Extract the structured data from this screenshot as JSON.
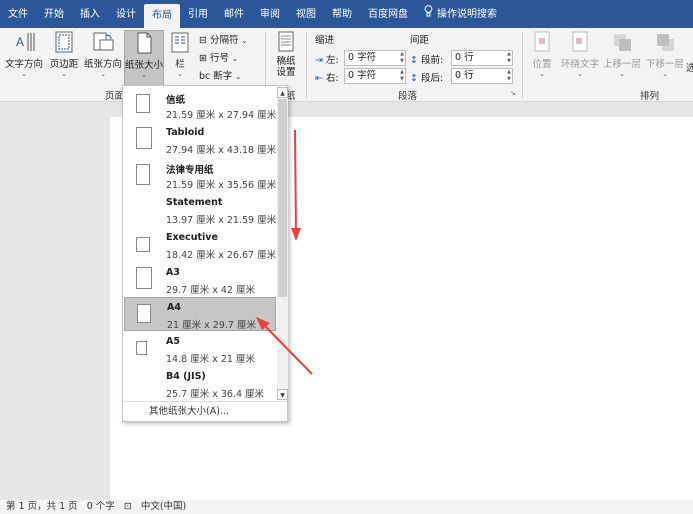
{
  "tabs": [
    {
      "label": "文件"
    },
    {
      "label": "开始"
    },
    {
      "label": "插入"
    },
    {
      "label": "设计"
    },
    {
      "label": "布局"
    },
    {
      "label": "引用"
    },
    {
      "label": "邮件"
    },
    {
      "label": "审阅"
    },
    {
      "label": "视图"
    },
    {
      "label": "帮助"
    },
    {
      "label": "百度网盘"
    },
    {
      "label": "操作说明搜索"
    }
  ],
  "ribbon": {
    "text_direction": "文字方向",
    "margins": "页边距",
    "orientation": "纸张方向",
    "size": "纸张大小",
    "columns": "栏",
    "breaks": "分隔符",
    "line_numbers": "行号",
    "hyphenation": "断字",
    "page_setup_group": "页面",
    "draft_settings": "稿纸\n设置",
    "draft_group": "纸",
    "indent": "缩进",
    "spacing": "间距",
    "left_label": "左:",
    "right_label": "右:",
    "before_label": "段前:",
    "after_label": "段后:",
    "left_value": "0 字符",
    "right_value": "0 字符",
    "before_value": "0 行",
    "after_value": "0 行",
    "paragraph_group": "段落",
    "position": "位置",
    "wrap_text": "环绕文字",
    "bring_forward": "上移一层",
    "send_backward": "下移一层",
    "align": "选",
    "arrange_group": "排列"
  },
  "paper_sizes": [
    {
      "name": "信纸",
      "size": "21.59 厘米 x 27.94 厘米"
    },
    {
      "name": "Tabloid",
      "size": "27.94 厘米 x 43.18 厘米"
    },
    {
      "name": "法律专用纸",
      "size": "21.59 厘米 x 35.56 厘米"
    },
    {
      "name": "Statement",
      "size": "13.97 厘米 x 21.59 厘米"
    },
    {
      "name": "Executive",
      "size": "18.42 厘米 x 26.67 厘米"
    },
    {
      "name": "A3",
      "size": "29.7 厘米 x 42 厘米"
    },
    {
      "name": "A4",
      "size": "21 厘米 x 29.7 厘米"
    },
    {
      "name": "A5",
      "size": "14.8 厘米 x 21 厘米"
    },
    {
      "name": "B4 (JIS)",
      "size": "25.7 厘米 x 36.4 厘米"
    }
  ],
  "selected_paper": "A4",
  "more_sizes": "其他纸张大小(A)...",
  "status": {
    "page": "第 1 页，共 1 页",
    "words": "0 个字",
    "language": "中文(中国)"
  },
  "colors": {
    "accent": "#2b579a",
    "annotation": "#e8413c"
  }
}
